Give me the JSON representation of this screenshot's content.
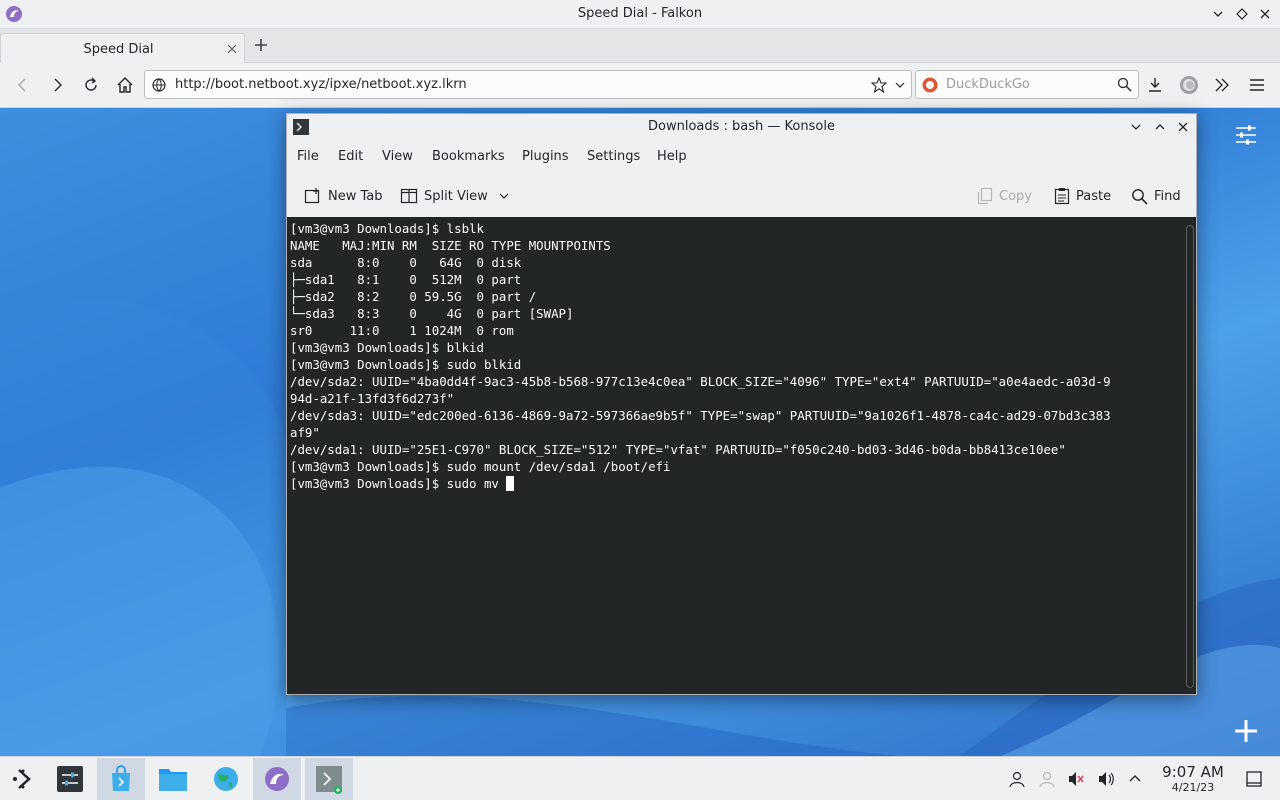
{
  "falkon": {
    "window_title": "Speed Dial - Falkon",
    "tab_label": "Speed Dial",
    "url": "http://boot.netboot.xyz/ipxe/netboot.xyz.lkrn",
    "search_placeholder": "DuckDuckGo"
  },
  "konsole": {
    "window_title": "Downloads : bash — Konsole",
    "menu": [
      "File",
      "Edit",
      "View",
      "Bookmarks",
      "Plugins",
      "Settings",
      "Help"
    ],
    "toolbar": {
      "new_tab": "New Tab",
      "split_view": "Split View",
      "copy": "Copy",
      "paste": "Paste",
      "find": "Find"
    },
    "terminal_lines": [
      "[vm3@vm3 Downloads]$ lsblk",
      "NAME   MAJ:MIN RM  SIZE RO TYPE MOUNTPOINTS",
      "sda      8:0    0   64G  0 disk",
      "├─sda1   8:1    0  512M  0 part",
      "├─sda2   8:2    0 59.5G  0 part /",
      "└─sda3   8:3    0    4G  0 part [SWAP]",
      "sr0     11:0    1 1024M  0 rom",
      "[vm3@vm3 Downloads]$ blkid",
      "[vm3@vm3 Downloads]$ sudo blkid",
      "/dev/sda2: UUID=\"4ba0dd4f-9ac3-45b8-b568-977c13e4c0ea\" BLOCK_SIZE=\"4096\" TYPE=\"ext4\" PARTUUID=\"a0e4aedc-a03d-9",
      "94d-a21f-13fd3f6d273f\"",
      "/dev/sda3: UUID=\"edc200ed-6136-4869-9a72-597366ae9b5f\" TYPE=\"swap\" PARTUUID=\"9a1026f1-4878-ca4c-ad29-07bd3c383",
      "af9\"",
      "/dev/sda1: UUID=\"25E1-C970\" BLOCK_SIZE=\"512\" TYPE=\"vfat\" PARTUUID=\"f050c240-bd03-3d46-b0da-bb8413ce10ee\"",
      "[vm3@vm3 Downloads]$ sudo mount /dev/sda1 /boot/efi"
    ],
    "prompt_current": "[vm3@vm3 Downloads]$ sudo mv "
  },
  "taskbar": {
    "clock_time": "9:07 AM",
    "clock_date": "4/21/23"
  }
}
